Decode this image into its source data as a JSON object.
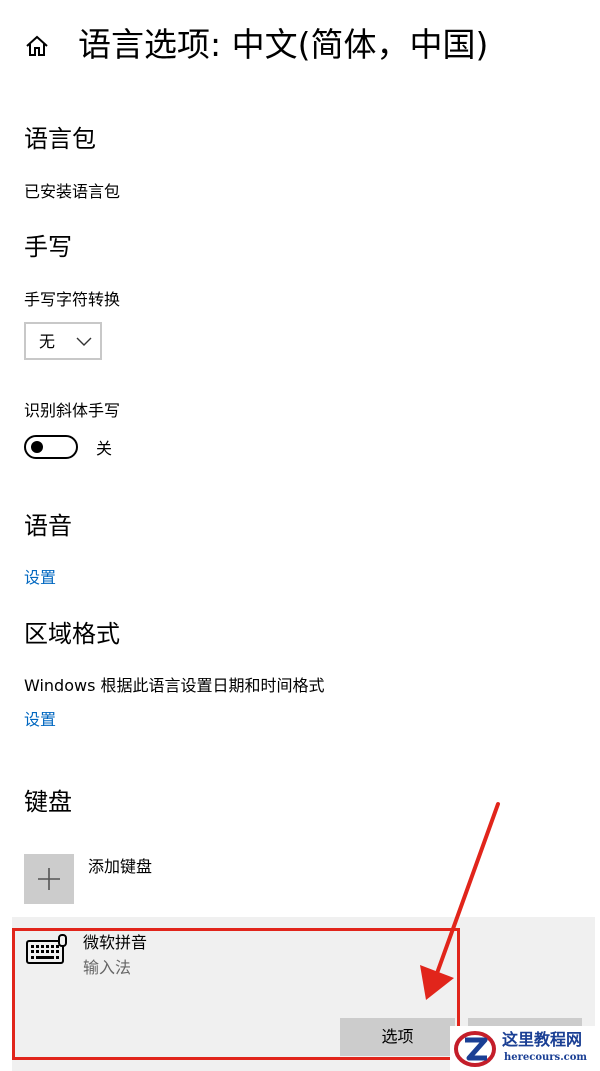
{
  "header": {
    "title": "语言选项: 中文(简体，中国)",
    "home_icon": "home-icon"
  },
  "language_pack": {
    "heading": "语言包",
    "status": "已安装语言包"
  },
  "handwriting": {
    "heading": "手写",
    "conversion_label": "手写字符转换",
    "conversion_value": "无",
    "italic_label": "识别斜体手写",
    "italic_toggle_state": "关"
  },
  "speech": {
    "heading": "语音",
    "settings_link": "设置"
  },
  "region": {
    "heading": "区域格式",
    "description": "Windows 根据此语言设置日期和时间格式",
    "settings_link": "设置"
  },
  "keyboard": {
    "heading": "键盘",
    "add_label": "添加键盘",
    "items": [
      {
        "name": "微软拼音",
        "subtitle": "输入法",
        "options_label": "选项",
        "icon": "keyboard-icon"
      }
    ]
  },
  "watermark": {
    "name_cn": "这里教程网",
    "site": "herecours.com"
  },
  "colors": {
    "link": "#0067c0",
    "highlight": "#e1251b",
    "button": "#cccccc",
    "item_bg": "#f0f0f0"
  }
}
